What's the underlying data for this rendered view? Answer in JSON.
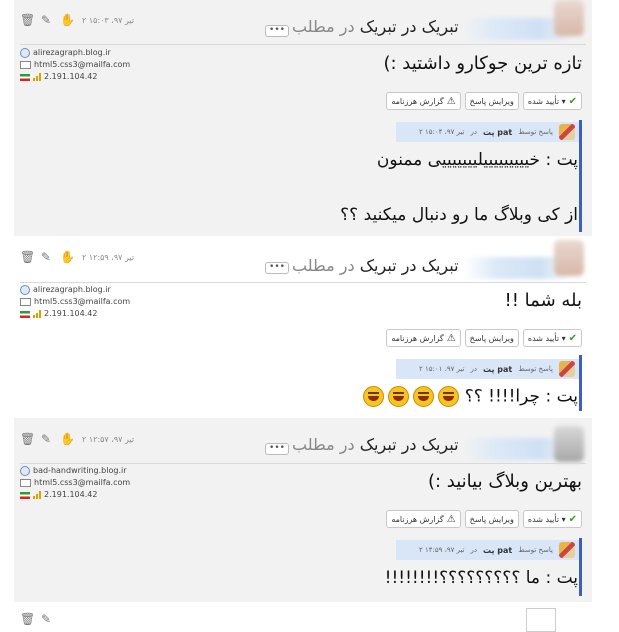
{
  "comments": [
    {
      "date": "۲ تیر ۹۷، ۱۵:۰۳",
      "title_prefix": "در مطلب",
      "title": "تبریک در تبریک",
      "more": "•••",
      "site": "alirezagraph.blog.ir",
      "email": "html5.css3@mailfa.com",
      "ip": "2.191.104.42",
      "text": "تازه ترین جوکارو داشتید :)",
      "buttons": {
        "approved": "تأیید شده ▾",
        "edit_reply": "ویرایش پاسخ",
        "report_spam": "گزارش هرزنامه"
      },
      "reply": {
        "label": "پاسخ توسط",
        "name": "پت pat",
        "in": "در",
        "date": "۲ تیر ۹۷، ۱۵:۰۴",
        "lines": [
          "پت : خیییییییییلیییییییی ممنون",
          "از کی وبلاگ ما رو دنبال میکنید ؟؟"
        ]
      }
    },
    {
      "date": "۲ تیر ۹۷، ۱۲:۵۹",
      "title_prefix": "در مطلب",
      "title": "تبریک در تبریک",
      "more": "•••",
      "site": "alirezagraph.blog.ir",
      "email": "html5.css3@mailfa.com",
      "ip": "2.191.104.42",
      "text": "بله شما !!",
      "buttons": {
        "approved": "تأیید شده ▾",
        "edit_reply": "ویرایش پاسخ",
        "report_spam": "گزارش هرزنامه"
      },
      "reply": {
        "label": "پاسخ توسط",
        "name": "پت pat",
        "in": "در",
        "date": "۲ تیر ۹۷، ۱۵:۰۱",
        "lines": [
          "پت : چرا!!!! ؟؟"
        ]
      }
    },
    {
      "date": "۲ تیر ۹۷، ۱۲:۵۷",
      "title_prefix": "در مطلب",
      "title": "تبریک در تبریک",
      "more": "•••",
      "site": "bad-handwriting.blog.ir",
      "email": "html5.css3@mailfa.com",
      "ip": "2.191.104.42",
      "text": "بهترین وبلاگ بیانید :)",
      "buttons": {
        "approved": "تأیید شده ▾",
        "edit_reply": "ویرایش پاسخ",
        "report_spam": "گزارش هرزنامه"
      },
      "reply": {
        "label": "پاسخ توسط",
        "name": "پت pat",
        "in": "در",
        "date": "۲ تیر ۹۷، ۱۴:۵۹",
        "lines": [
          "پت : ما ؟؟؟؟؟؟؟؟؟!!!!!!!!"
        ]
      }
    }
  ],
  "colors": {
    "accent": "#3f5fbf",
    "reply_header": "#d9e6f7",
    "approved_check": "#3a9a2a"
  },
  "icons": [
    "trash-icon",
    "pencil-icon",
    "hand-icon",
    "globe-icon",
    "mail-icon",
    "flag-icon",
    "signal-icon",
    "check-icon",
    "warning-icon",
    "laugh-emoji-icon"
  ]
}
